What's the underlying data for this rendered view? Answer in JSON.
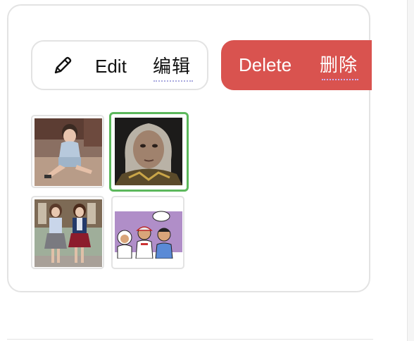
{
  "toolbar": {
    "edit_label": "Edit",
    "edit_label_cn": "编辑",
    "delete_label": "Delete",
    "delete_label_cn": "删除"
  },
  "colors": {
    "delete_bg": "#d9534f",
    "selected_border": "#5cb85c",
    "card_border": "#e3e3e3",
    "dotted_underline": "#a9a9df"
  },
  "thumbnails": [
    {
      "icon": "boy-sitting-photo",
      "selected": false
    },
    {
      "icon": "elderly-woman-portrait",
      "selected": true
    },
    {
      "icon": "two-women-photo",
      "selected": false
    },
    {
      "icon": "cartoon-kids-speech-bubble",
      "selected": false
    }
  ]
}
